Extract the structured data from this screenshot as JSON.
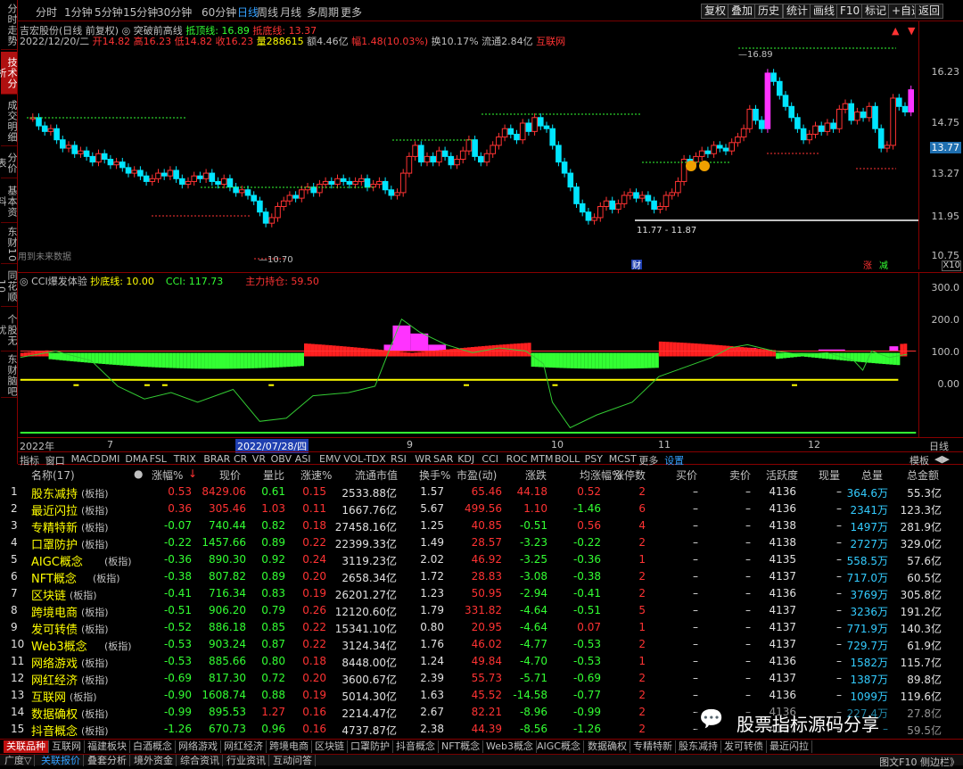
{
  "sidebar": {
    "tabs": [
      "分时走势",
      "技术分析",
      "成交明细",
      "分价表",
      "基本资料",
      "东财10",
      "同花顺10",
      "个股无忧",
      "东财脑吧"
    ],
    "active": 1
  },
  "periods": [
    "分时",
    "1分钟",
    "5分钟",
    "15分钟",
    "30分钟",
    "60分钟",
    "日线",
    "周线",
    "月线",
    "多周期",
    "更多"
  ],
  "active_period": "日线",
  "toolbar": [
    "复权",
    "叠加",
    "历史",
    "统计",
    "画线",
    "F10",
    "标记",
    "+自选",
    "返回"
  ],
  "stock": {
    "title": "吉宏股份(日线 前复权)",
    "indicator_name": "突破前高线",
    "line1_label": "抵顶线: 16.89",
    "line2_label": "抵底线: 13.37",
    "info_date": "2022/12/20/二",
    "open": "开14.82",
    "high": "高16.23",
    "low": "低14.82",
    "close": "收16.23",
    "volume": "量288615",
    "amount": "额4.46亿",
    "change": "幅1.48(10.03%)",
    "turnover": "换10.17%",
    "float": "流通2.84亿",
    "concept": "互联网"
  },
  "price_axis": [
    "16.23",
    "14.75",
    "13.77",
    "13.27",
    "11.95",
    "10.75",
    "X10"
  ],
  "price_annotations": {
    "high": "16.89",
    "low": "10.70",
    "range": "11.77 - 11.87",
    "future": "用到未来数据",
    "cai": "财",
    "zhang": "涨",
    "jian": "减"
  },
  "indicator": {
    "title": "CCI爆发体验",
    "label1": "抄底线: 10.00",
    "label2": "CCI: 117.73",
    "label3": "主力持仓: 59.50",
    "axis": [
      "300.0",
      "200.0",
      "100.0",
      "0.00"
    ]
  },
  "date_axis": [
    "2022年",
    "7",
    "2022/07/28/四",
    "9",
    "10",
    "11",
    "12",
    "日线"
  ],
  "indicator_tabs": [
    "指标",
    "窗口",
    "MACD",
    "DMI",
    "DMA",
    "FSL",
    "TRIX",
    "BRAR",
    "CR",
    "VR",
    "OBV",
    "ASI",
    "EMV",
    "VOL-TDX",
    "RSI",
    "WR",
    "SAR",
    "KDJ",
    "CCI",
    "ROC",
    "MTM",
    "BOLL",
    "PSY",
    "MCST",
    "更多",
    "设置"
  ],
  "indicator_tab_right": [
    "模板",
    "◀▶"
  ],
  "table": {
    "headers": [
      "名称(17)",
      "●",
      "涨幅%",
      "现价",
      "量比",
      "涨速%",
      "流通市值",
      "换手%",
      "市盈(动)",
      "涨跌",
      "均涨幅%",
      "涨停数",
      "买价",
      "卖价",
      "活跃度",
      "现量",
      "总量",
      "总金额"
    ],
    "rows": [
      [
        "1",
        "股东减持",
        "(板指)",
        "0.53",
        "8429.06",
        "0.61",
        "0.15",
        "2533.88亿",
        "1.57",
        "65.46",
        "44.18",
        "0.52",
        "2",
        "–",
        "–",
        "4136",
        "–",
        "364.6万",
        "55.3亿"
      ],
      [
        "2",
        "最近闪拉",
        "(板指)",
        "0.36",
        "305.46",
        "1.03",
        "0.11",
        "1667.76亿",
        "5.67",
        "499.56",
        "1.10",
        "-1.46",
        "6",
        "–",
        "–",
        "4136",
        "–",
        "2341万",
        "123.3亿"
      ],
      [
        "3",
        "专精特新",
        "(板指)",
        "-0.07",
        "740.44",
        "0.82",
        "0.18",
        "27458.16亿",
        "1.25",
        "40.85",
        "-0.51",
        "0.56",
        "4",
        "–",
        "–",
        "4138",
        "–",
        "1497万",
        "281.9亿"
      ],
      [
        "4",
        "口罩防护",
        "(板指)",
        "-0.22",
        "1457.66",
        "0.89",
        "0.22",
        "22399.33亿",
        "1.49",
        "28.57",
        "-3.23",
        "-0.22",
        "2",
        "–",
        "–",
        "4138",
        "–",
        "2727万",
        "329.0亿"
      ],
      [
        "5",
        "AIGC概念",
        "(板指)",
        "-0.36",
        "890.30",
        "0.92",
        "0.24",
        "3119.23亿",
        "2.02",
        "46.92",
        "-3.25",
        "-0.36",
        "1",
        "–",
        "–",
        "4135",
        "–",
        "558.5万",
        "57.6亿"
      ],
      [
        "6",
        "NFT概念",
        "(板指)",
        "-0.38",
        "807.82",
        "0.89",
        "0.20",
        "2658.34亿",
        "1.72",
        "28.83",
        "-3.08",
        "-0.38",
        "2",
        "–",
        "–",
        "4137",
        "–",
        "717.0万",
        "60.5亿"
      ],
      [
        "7",
        "区块链",
        "(板指)",
        "-0.41",
        "716.34",
        "0.83",
        "0.19",
        "26201.27亿",
        "1.23",
        "50.95",
        "-2.94",
        "-0.41",
        "2",
        "–",
        "–",
        "4136",
        "–",
        "3769万",
        "305.8亿"
      ],
      [
        "8",
        "跨境电商",
        "(板指)",
        "-0.51",
        "906.20",
        "0.79",
        "0.26",
        "12120.60亿",
        "1.79",
        "331.82",
        "-4.64",
        "-0.51",
        "5",
        "–",
        "–",
        "4137",
        "–",
        "3236万",
        "191.2亿"
      ],
      [
        "9",
        "发可转债",
        "(板指)",
        "-0.52",
        "886.18",
        "0.85",
        "0.22",
        "15341.10亿",
        "0.80",
        "20.95",
        "-4.64",
        "0.07",
        "1",
        "–",
        "–",
        "4137",
        "–",
        "771.9万",
        "140.3亿"
      ],
      [
        "10",
        "Web3概念",
        "(板指)",
        "-0.53",
        "903.24",
        "0.87",
        "0.22",
        "3124.34亿",
        "1.76",
        "46.02",
        "-4.77",
        "-0.53",
        "2",
        "–",
        "–",
        "4137",
        "–",
        "729.7万",
        "61.9亿"
      ],
      [
        "11",
        "网络游戏",
        "(板指)",
        "-0.53",
        "885.66",
        "0.80",
        "0.18",
        "8448.00亿",
        "1.24",
        "49.84",
        "-4.70",
        "-0.53",
        "1",
        "–",
        "–",
        "4136",
        "–",
        "1582万",
        "115.7亿"
      ],
      [
        "12",
        "网红经济",
        "(板指)",
        "-0.69",
        "817.30",
        "0.72",
        "0.20",
        "3600.67亿",
        "2.39",
        "55.73",
        "-5.71",
        "-0.69",
        "2",
        "–",
        "–",
        "4137",
        "–",
        "1387万",
        "89.8亿"
      ],
      [
        "13",
        "互联网",
        "(板指)",
        "-0.90",
        "1608.74",
        "0.88",
        "0.19",
        "5014.30亿",
        "1.63",
        "45.52",
        "-14.58",
        "-0.77",
        "2",
        "–",
        "–",
        "4136",
        "–",
        "1099万",
        "119.6亿"
      ],
      [
        "14",
        "数据确权",
        "(板指)",
        "-0.99",
        "895.53",
        "1.27",
        "0.16",
        "2214.47亿",
        "2.67",
        "82.21",
        "-8.96",
        "-0.99",
        "2",
        "–",
        "–",
        "4136",
        "–",
        "227.4万",
        "27.8亿"
      ],
      [
        "15",
        "抖音概念",
        "(板指)",
        "-1.26",
        "670.73",
        "0.96",
        "0.16",
        "4737.87亿",
        "2.38",
        "44.39",
        "-8.56",
        "-1.26",
        "2",
        "–",
        "–",
        "4137",
        "–",
        "–",
        "59.5亿"
      ]
    ]
  },
  "sector_tabs": [
    "关联品种",
    "互联网",
    "福建板块",
    "白酒概念",
    "网络游戏",
    "网红经济",
    "跨境电商",
    "区块链",
    "口罩防护",
    "抖音概念",
    "NFT概念",
    "Web3概念",
    "AIGC概念",
    "数据确权",
    "专精特新",
    "股东减持",
    "发可转债",
    "最近闪拉"
  ],
  "bottom_tabs": [
    "广度▽",
    "关联报价",
    "叠套分析",
    "境外资金",
    "综合资讯",
    "行业资讯",
    "互动问答"
  ],
  "bottom_right": "图文F10  侧边栏》",
  "watermark": "股票指标源码分享"
}
